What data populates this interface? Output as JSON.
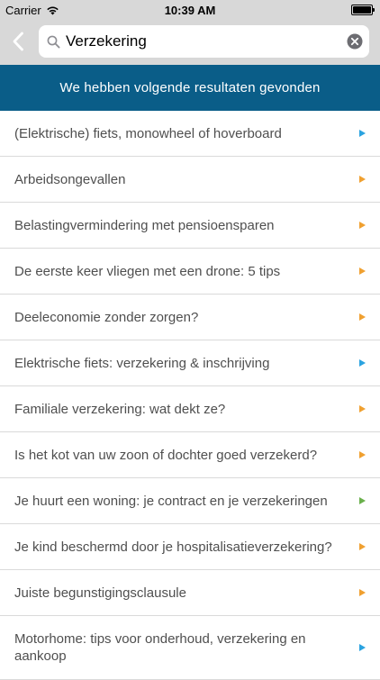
{
  "statusbar": {
    "carrier": "Carrier",
    "time": "10:39 AM"
  },
  "search": {
    "value": "Verzekering",
    "placeholder": "Zoeken"
  },
  "banner": {
    "text": "We hebben volgende resultaten gevonden"
  },
  "colors": {
    "banner_bg": "#0a5d88",
    "arrow_orange": "#f0a030",
    "arrow_blue": "#2ba3e0",
    "arrow_green": "#6ab04c"
  },
  "results": [
    {
      "label": "(Elektrische) fiets, monowheel of hoverboard",
      "arrow": "blue"
    },
    {
      "label": "Arbeidsongevallen",
      "arrow": "orange"
    },
    {
      "label": "Belastingvermindering met pensioensparen",
      "arrow": "orange"
    },
    {
      "label": "De eerste keer vliegen met een drone: 5 tips",
      "arrow": "orange"
    },
    {
      "label": "Deeleconomie zonder zorgen?",
      "arrow": "orange"
    },
    {
      "label": "Elektrische fiets: verzekering & inschrijving",
      "arrow": "blue"
    },
    {
      "label": "Familiale verzekering: wat dekt ze?",
      "arrow": "orange"
    },
    {
      "label": "Is het kot van uw zoon of dochter goed verzekerd?",
      "arrow": "orange"
    },
    {
      "label": "Je huurt een woning: je contract en je verzekeringen",
      "arrow": "green"
    },
    {
      "label": "Je kind beschermd door je hospitalisatieverzekering?",
      "arrow": "orange"
    },
    {
      "label": "Juiste begunstigingsclausule",
      "arrow": "orange"
    },
    {
      "label": "Motorhome: tips voor onderhoud, verzekering en aankoop",
      "arrow": "blue"
    }
  ]
}
